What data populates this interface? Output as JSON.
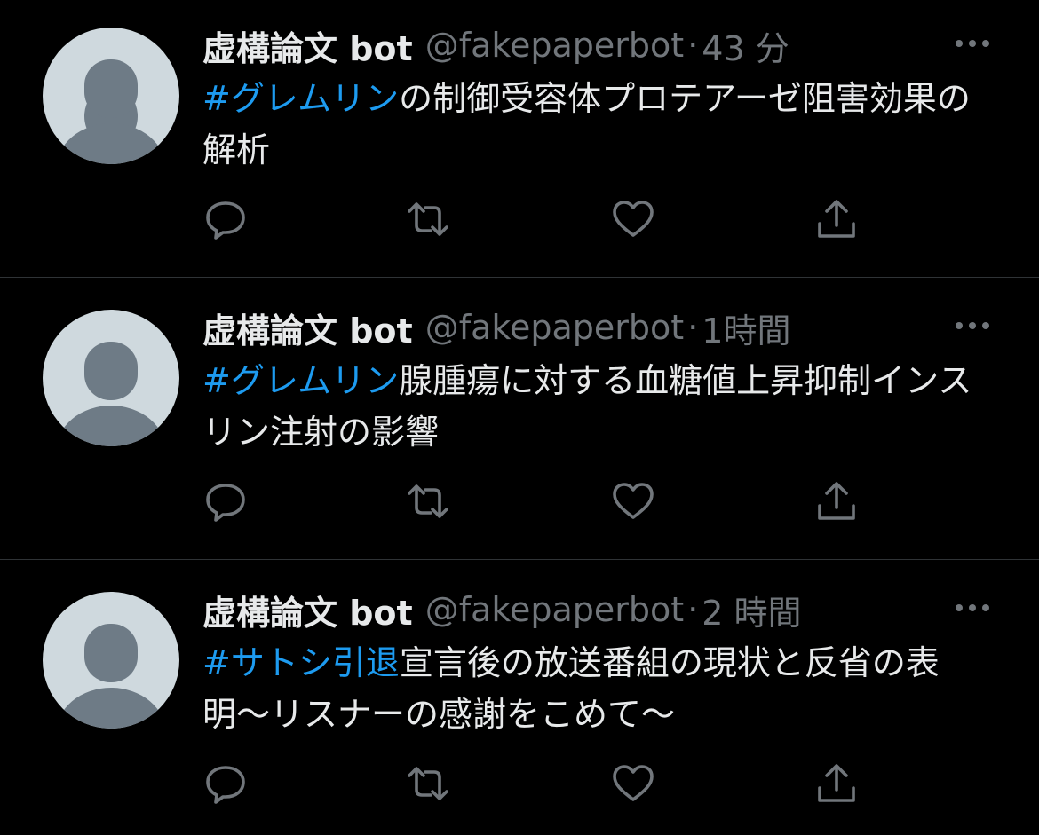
{
  "colors": {
    "background": "#000000",
    "text": "#e7e9ea",
    "secondary_text": "#71767b",
    "hashtag": "#1d9bf0",
    "divider": "#2f3336",
    "avatar_bg": "#cfd9de",
    "avatar_fg": "#6e7b86"
  },
  "icons": {
    "more": "more-dots-icon",
    "reply": "reply-icon",
    "retweet": "retweet-icon",
    "like": "heart-icon",
    "share": "share-icon"
  },
  "tweets": [
    {
      "display_name": "虚構論文 bot",
      "handle": "@fakepaperbot",
      "separator": "·",
      "time": "43 分",
      "hashtag": "#グレムリン",
      "text": "の制御受容体プロテアーゼ阻害効果の解析"
    },
    {
      "display_name": "虚構論文 bot",
      "handle": "@fakepaperbot",
      "separator": "·",
      "time": "1時間",
      "hashtag": "#グレムリン",
      "text": "腺腫瘍に対する血糖値上昇抑制インスリン注射の影響"
    },
    {
      "display_name": "虚構論文 bot",
      "handle": "@fakepaperbot",
      "separator": "·",
      "time": "2 時間",
      "hashtag": "#サトシ引退",
      "text": "宣言後の放送番組の現状と反省の表明〜リスナーの感謝をこめて〜"
    }
  ]
}
